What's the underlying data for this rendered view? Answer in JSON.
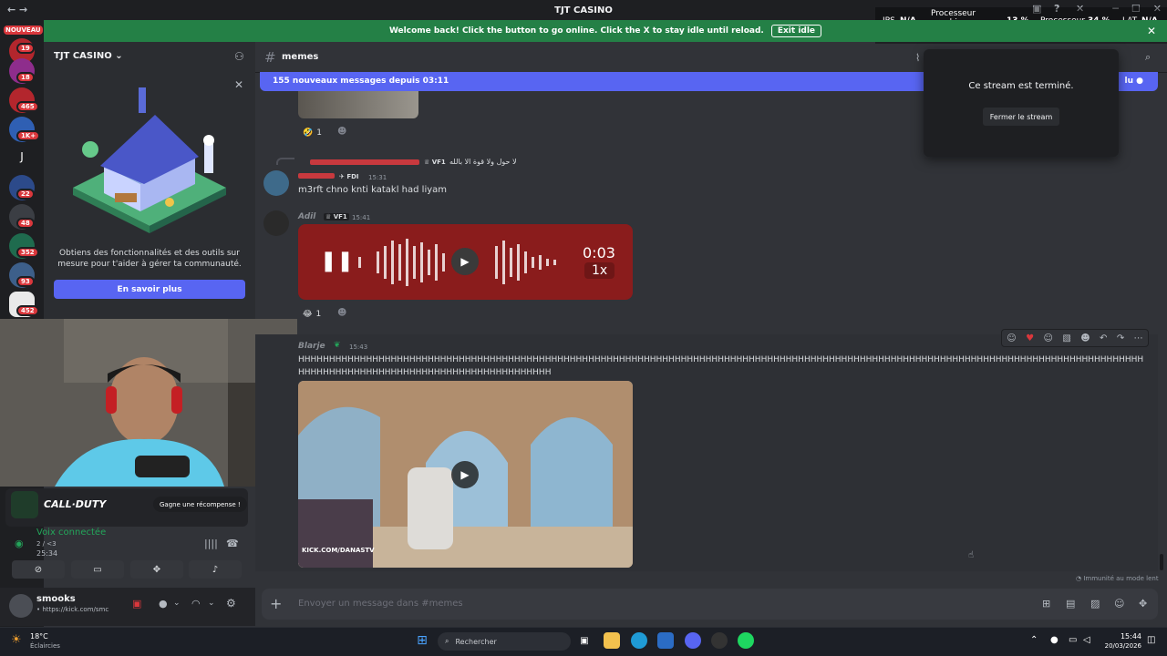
{
  "window": {
    "title": "TJT CASINO"
  },
  "banner": {
    "text": "Welcome back! Click the button to go online. Click the X to stay idle until reload.",
    "exit_label": "Exit idle",
    "close": "✕"
  },
  "stats": {
    "ips_label": "IPS",
    "ips_value": "N/A",
    "gpu_label": "Processeur graphique",
    "gpu_value": "13 %",
    "cpu_label": "Processeur",
    "cpu_value": "34 %",
    "lat_label": "LAT",
    "lat_value": "N/A"
  },
  "rail": {
    "nouveau": "NOUVEAU",
    "servers": [
      {
        "badge": "19",
        "color": "#b3262d"
      },
      {
        "badge": "18",
        "color": "#8e2d8c"
      },
      {
        "badge": "465",
        "color": "#b3262d"
      },
      {
        "badge": "1K+",
        "color": "#2f5fb3"
      },
      {
        "letter": "J",
        "color": "#1e1f22"
      },
      {
        "badge": "22",
        "color": "#2c4a8a"
      },
      {
        "badge": "48",
        "color": "#3b3e44"
      },
      {
        "badge": "352",
        "color": "#1f6b4e"
      },
      {
        "badge": "93",
        "color": "#3d5f8a"
      },
      {
        "badge": "452",
        "color": "#e9e9e9"
      }
    ]
  },
  "sidebar": {
    "server_name": "TJT CASINO",
    "server_chevron": "⌄",
    "promo_text": "Obtiens des fonctionnalités et des outils sur mesure pour t'aider à gérer ta communauté.",
    "promo_button": "En savoir plus"
  },
  "activity": {
    "game": "CALL·DUTY",
    "reward_button": "Gagne une récompense !"
  },
  "voice": {
    "status": "Voix connectée",
    "sub": "2 / <3",
    "elapsed": "25:34"
  },
  "user": {
    "name": "smooks",
    "status": "• https://kick.com/smc"
  },
  "channel": {
    "name": "memes",
    "new_messages": "155 nouveaux messages depuis 03:11",
    "mark_read": "lu"
  },
  "stream": {
    "ended": "Ce stream est terminé.",
    "close_button": "Fermer le stream"
  },
  "messages": [
    {
      "reactions": [
        {
          "emoji": "🤣",
          "count": "1"
        }
      ]
    },
    {
      "reply_preview": "لا حول ولا قوة الا بالله",
      "reply_tag": "VF1",
      "tag": "FDI",
      "time": "15:31",
      "text": "m3rft chno knti katakl had liyam"
    },
    {
      "author": "Adil",
      "tag": "VF1",
      "time": "15:41",
      "voice_duration": "0:03",
      "voice_speed": "1x",
      "reactions": [
        {
          "emoji": "😂",
          "count": "1"
        }
      ]
    },
    {
      "author": "Blarje",
      "time": "15:43",
      "text": "HHHHHHHHHHHHHHHHHHHHHHHHHHHHHHHHHHHHHHHHHHHHHHHHHHHHHHHHHHHHHHHHHHHHHHHHHHHHHHHHHHHHHHHHHHHHHHHHHHHHHHHHHHHHHHHHHHHHHHHHHHHHHHHHHHHHHHHHHHHHHHHHHHHHHHHHHHHHHHHHHHHHHHHHHHHHHHHHHH",
      "video_watermark": "KICK.COM/DANASTV"
    }
  ],
  "footer_note": "Immunité au mode lent",
  "composer": {
    "placeholder": "Envoyer un message dans #memes"
  },
  "taskbar": {
    "temp": "18°C",
    "weather": "Éclaircies",
    "search": "Rechercher",
    "time": "15:44",
    "date": "20/03/2026"
  }
}
